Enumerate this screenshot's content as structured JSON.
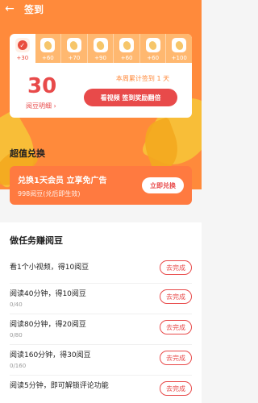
{
  "header": {
    "title": "签到",
    "back_icon": "arrow-left-icon",
    "bg_color": "#ff8a3b"
  },
  "checkin": {
    "days": [
      {
        "points": "+30",
        "checked": true
      },
      {
        "points": "+60",
        "checked": false
      },
      {
        "points": "+70",
        "checked": false
      },
      {
        "points": "+90",
        "checked": false
      },
      {
        "points": "+60",
        "checked": false
      },
      {
        "points": "+60",
        "checked": false
      },
      {
        "points": "+100",
        "checked": false
      }
    ],
    "total": "30",
    "detail_label": "阅豆明细 ›",
    "weekly_text": "本周累计签到 1 天",
    "double_button": "看视频 签到奖励翻倍"
  },
  "exchange": {
    "section_title": "超值兑换",
    "title": "兑换1天会员 立享免广告",
    "subtitle": "998阅豆(兑后即生效)",
    "button": "立即兑换"
  },
  "tasks": {
    "section_title": "做任务赚阅豆",
    "items": [
      {
        "name": "看1个小视频，得10阅豆",
        "progress": "",
        "button": "去完成"
      },
      {
        "name": "阅读40分钟，得10阅豆",
        "progress": "0/40",
        "button": "去完成"
      },
      {
        "name": "阅读80分钟，得20阅豆",
        "progress": "0/80",
        "button": "去完成"
      },
      {
        "name": "阅读160分钟，得30阅豆",
        "progress": "0/160",
        "button": "去完成"
      },
      {
        "name": "阅读5分钟，即可解锁评论功能",
        "progress": "",
        "button": "去完成"
      }
    ]
  }
}
